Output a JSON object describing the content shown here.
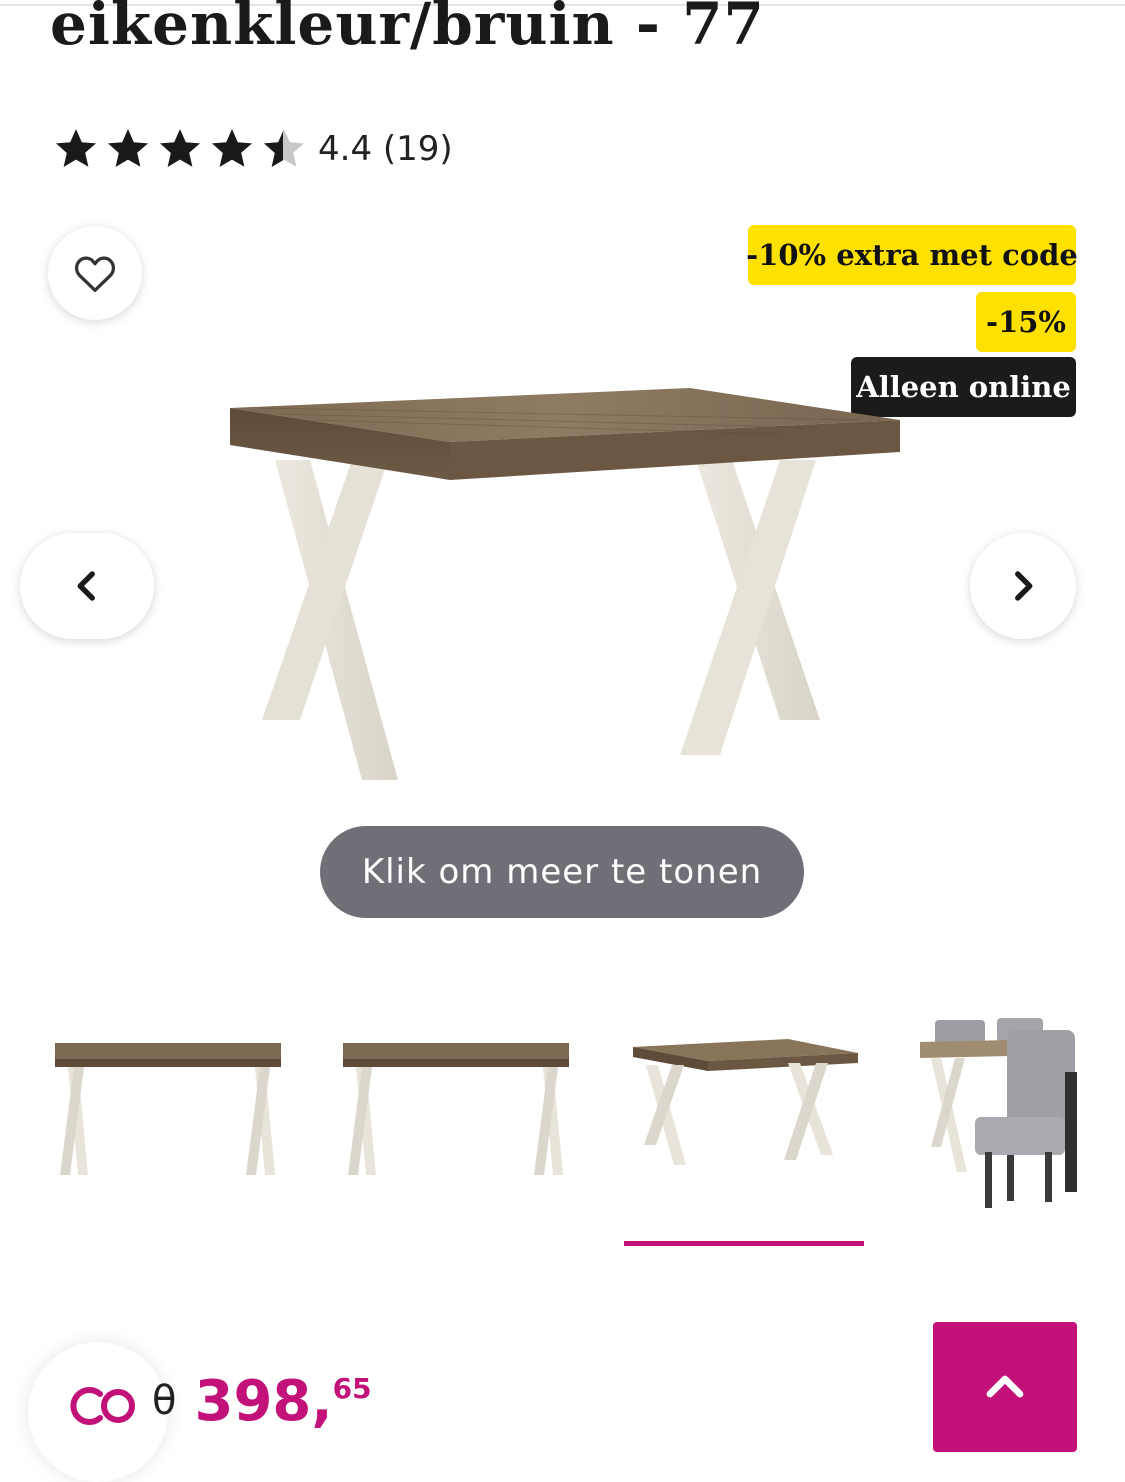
{
  "product": {
    "title": "eikenkleur/bruin - 77",
    "rating_value": 4.4,
    "rating_text": "4.4 (19)"
  },
  "badges": {
    "extra_code": "-10% extra met code",
    "discount": "-15%",
    "online_only": "Alleen online"
  },
  "gallery": {
    "more_button_label": "Klik om meer te tonen",
    "active_thumbnail": 3
  },
  "price": {
    "old_marker": "θ",
    "main": "398,",
    "cents": "65"
  },
  "icons": {
    "favorite": "heart-outline-icon",
    "prev": "chevron-left-icon",
    "next": "chevron-right-icon",
    "scroll_top": "chevron-up-icon",
    "loyalty": "co-icon"
  },
  "colors": {
    "accent": "#c2127a",
    "badge_yellow": "#ffe100",
    "badge_dark": "#1b1b1b",
    "more_button": "#6f6f78"
  }
}
